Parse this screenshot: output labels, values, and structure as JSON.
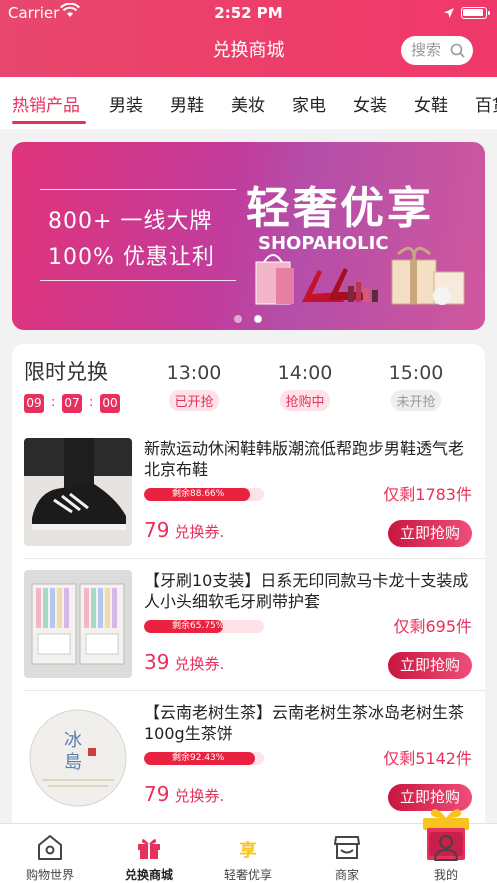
{
  "status": {
    "carrier": "Carrier",
    "time": "2:52 PM"
  },
  "header": {
    "title": "兑换商城",
    "search_label": "搜索"
  },
  "categories": [
    "热销产品",
    "男装",
    "男鞋",
    "美妆",
    "家电",
    "女装",
    "女鞋",
    "百货"
  ],
  "active_category": 0,
  "banner": {
    "line1": "800+ 一线大牌",
    "line2": "100% 优惠让利",
    "headline": "轻奢优享",
    "subheadline": "SHOPAHOLIC",
    "slide_count": 2,
    "active_slide": 1
  },
  "flash_sale": {
    "title": "限时兑换",
    "countdown": [
      "09",
      "07",
      "00"
    ],
    "slots": [
      {
        "time": "13:00",
        "status": "已开抢",
        "style": "red"
      },
      {
        "time": "14:00",
        "status": "抢购中",
        "style": "red"
      },
      {
        "time": "15:00",
        "status": "未开抢",
        "style": "gray"
      }
    ],
    "items": [
      {
        "name": "新款运动休闲鞋韩版潮流低帮跑步男鞋透气老北京布鞋",
        "progress_text": "剩余88.66%",
        "progress": 0.8866,
        "remaining": "仅剩1783件",
        "price": "79",
        "price_unit": "兑换券.",
        "buy_label": "立即抢购"
      },
      {
        "name": "【牙刷10支装】日系无印同款马卡龙十支装成人小头细软毛牙刷带护套",
        "progress_text": "剩余65.75%",
        "progress": 0.6575,
        "remaining": "仅剩695件",
        "price": "39",
        "price_unit": "兑换券.",
        "buy_label": "立即抢购"
      },
      {
        "name": "【云南老树生茶】云南老树生茶冰岛老树生茶100g生茶饼",
        "progress_text": "剩余92.43%",
        "progress": 0.9243,
        "remaining": "仅剩5142件",
        "price": "79",
        "price_unit": "兑换券.",
        "buy_label": "立即抢购"
      }
    ]
  },
  "tabbar": {
    "items": [
      "购物世界",
      "兑换商城",
      "轻奢优享",
      "商家",
      "我的"
    ],
    "active": 1,
    "center_badge": "享"
  },
  "colors": {
    "accent": "#e8305d",
    "header": "#ec3f6a"
  }
}
